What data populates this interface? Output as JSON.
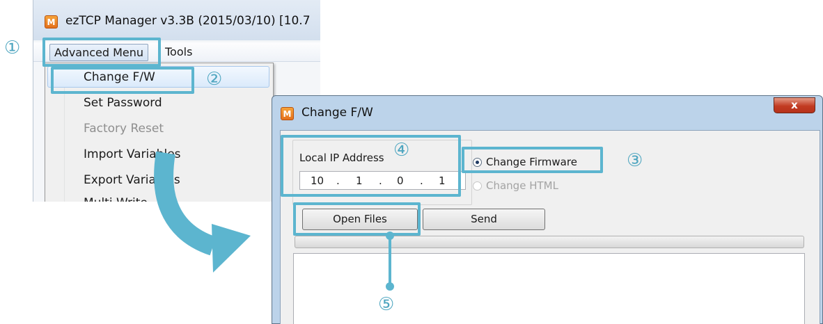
{
  "colors": {
    "accent": "#5cb5cf",
    "accent_text": "#4fa6c0",
    "close_red": "#c23b22",
    "app_icon": "#f08a2a"
  },
  "main_window": {
    "icon_glyph": "M",
    "title": "ezTCP Manager v3.3B (2015/03/10) [10.7",
    "menu": {
      "advanced": "Advanced Menu",
      "tools": "Tools"
    },
    "dropdown": [
      {
        "label": "Change F/W",
        "enabled": true
      },
      {
        "label": "Set Password",
        "enabled": true
      },
      {
        "label": "Factory Reset",
        "enabled": false
      },
      {
        "label": "Import Variables",
        "enabled": true
      },
      {
        "label": "Export Variables",
        "enabled": true
      },
      {
        "label": "Multi Write",
        "enabled": true
      }
    ]
  },
  "dialog": {
    "icon_glyph": "M",
    "title": "Change F/W",
    "close_glyph": "x",
    "ip_label": "Local IP Address",
    "ip_octets": [
      "10",
      "1",
      "0",
      "1"
    ],
    "ip_separator": ".",
    "radio_firmware": "Change Firmware",
    "radio_html": "Change HTML",
    "selected_option": "Change Firmware",
    "open_button": "Open Files",
    "send_button": "Send",
    "progress_percent": 0
  },
  "callouts": [
    "①",
    "②",
    "③",
    "④",
    "⑤"
  ]
}
